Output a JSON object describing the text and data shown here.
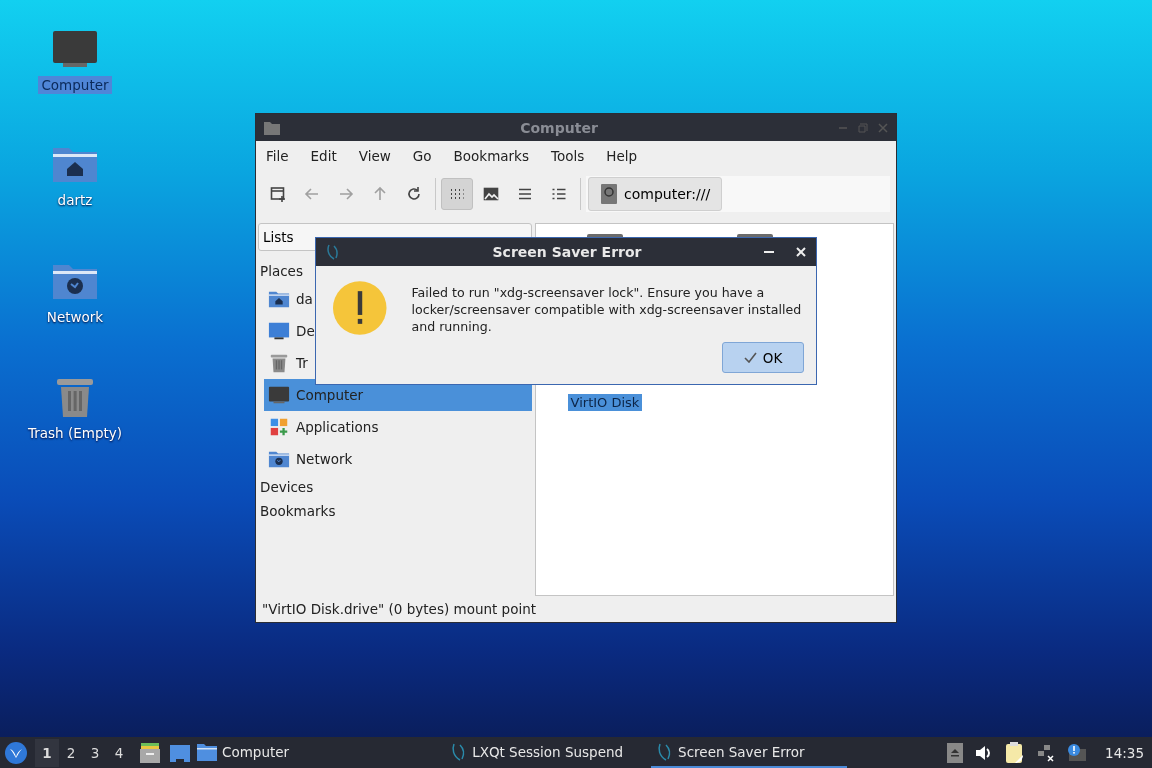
{
  "desktop_icons": [
    {
      "kind": "computer",
      "label": "Computer",
      "selected": true
    },
    {
      "kind": "home",
      "label": "dartz",
      "selected": false
    },
    {
      "kind": "network",
      "label": "Network",
      "selected": false
    },
    {
      "kind": "trash",
      "label": "Trash (Empty)",
      "selected": false
    }
  ],
  "file_manager": {
    "title": "Computer",
    "menu": [
      "File",
      "Edit",
      "View",
      "Go",
      "Bookmarks",
      "Tools",
      "Help"
    ],
    "toolbar": [
      {
        "kind": "new-window",
        "disabled": false,
        "selected": false
      },
      {
        "kind": "back",
        "disabled": true,
        "selected": false
      },
      {
        "kind": "forward",
        "disabled": true,
        "selected": false
      },
      {
        "kind": "up",
        "disabled": true,
        "selected": false
      },
      {
        "kind": "reload",
        "disabled": false,
        "selected": false
      },
      {
        "kind": "icon-view",
        "disabled": false,
        "selected": true
      },
      {
        "kind": "thumbnail-view",
        "disabled": false,
        "selected": false
      },
      {
        "kind": "compact-view",
        "disabled": false,
        "selected": false
      },
      {
        "kind": "detail-view",
        "disabled": false,
        "selected": false
      }
    ],
    "location": "computer:///",
    "side_pane": {
      "mode": "Lists",
      "sections": [
        {
          "title": "Places",
          "items": [
            {
              "kind": "home",
              "label": "da",
              "selected": false
            },
            {
              "kind": "desktop",
              "label": "De",
              "selected": false
            },
            {
              "kind": "trash",
              "label": "Tr",
              "selected": false
            },
            {
              "kind": "computer",
              "label": "Computer",
              "selected": true
            },
            {
              "kind": "applications",
              "label": "Applications",
              "selected": false
            },
            {
              "kind": "network",
              "label": "Network",
              "selected": false
            }
          ]
        },
        {
          "title": "Devices"
        },
        {
          "title": "Bookmarks"
        }
      ]
    },
    "files": [
      {
        "kind": "drive",
        "label": "VirtIO Disk",
        "selected": true
      },
      {
        "kind": "drive"
      }
    ],
    "status_bar": "\"VirtIO Disk.drive\" (0 bytes) mount point"
  },
  "dialog": {
    "title": "Screen Saver Error",
    "message": "Failed to run  \"xdg-screensaver lock\". Ensure you have a locker/screensaver compatible with xdg-screensaver installed and running.",
    "buttons": [
      "OK"
    ]
  },
  "taskbar": {
    "desktops": [
      {
        "label": "1",
        "selected": true
      },
      {
        "label": "2",
        "selected": false
      },
      {
        "label": "3",
        "selected": false
      },
      {
        "label": "4",
        "selected": false
      }
    ],
    "tasks": [
      {
        "kind": "folder",
        "label": "Computer",
        "selected": false
      },
      {
        "kind": "bird",
        "label": "LXQt Session Suspend",
        "selected": false
      },
      {
        "kind": "bird",
        "label": "Screen Saver Error",
        "selected": true
      }
    ],
    "clock": "14:35"
  }
}
